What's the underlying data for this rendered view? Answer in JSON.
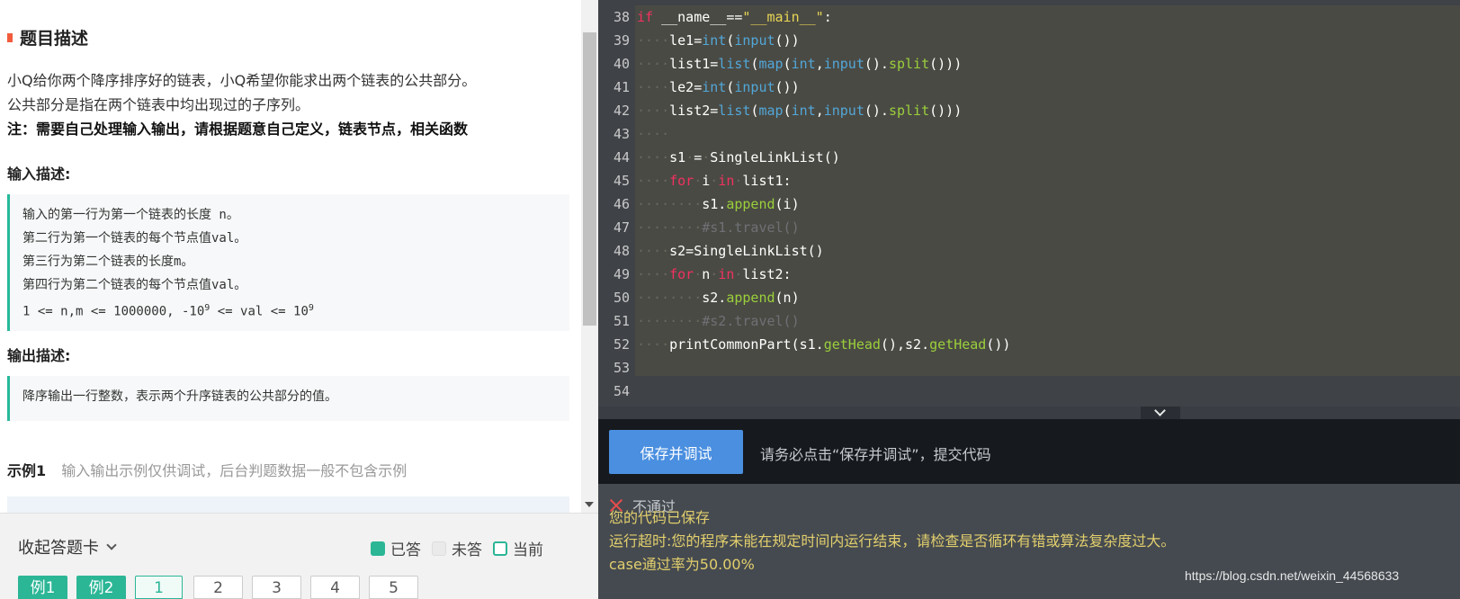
{
  "problem": {
    "section_title": "题目描述",
    "desc_lines": [
      "小Q给你两个降序排序好的链表，小Q希望你能求出两个链表的公共部分。",
      "公共部分是指在两个链表中均出现过的子序列。"
    ],
    "desc_note": "注：需要自己处理输入输出，请根据题意自己定义，链表节点，相关函数",
    "input_title": "输入描述:",
    "input_lines": [
      "输入的第一行为第一个链表的长度 n。",
      "第二行为第一个链表的每个节点值val。",
      "第三行为第二个链表的长度m。",
      "第四行为第二个链表的每个节点值val。"
    ],
    "input_range_prefix": "1 <= n,m <= 1000000, -10",
    "input_range_mid": " <= val <= 10",
    "input_range_exp": "9",
    "output_title": "输出描述:",
    "output_line": "降序输出一行整数，表示两个升序链表的公共部分的值。",
    "example_label": "示例1",
    "example_note": "输入输出示例仅供调试，后台判题数据一般不包含示例"
  },
  "answer_card": {
    "collapse_label": "收起答题卡",
    "legend_answered": "已答",
    "legend_unanswered": "未答",
    "legend_current": "当前",
    "buttons": [
      "例1",
      "例2",
      "1",
      "2",
      "3",
      "4",
      "5"
    ]
  },
  "editor": {
    "line_numbers": [
      "38",
      "39",
      "40",
      "41",
      "42",
      "43",
      "44",
      "45",
      "46",
      "47",
      "48",
      "49",
      "50",
      "51",
      "52",
      "53",
      "54"
    ]
  },
  "action": {
    "save_label": "保存并调试",
    "hint": "请务必点击“保存并调试”，提交代码"
  },
  "result": {
    "status": "不通过",
    "saved": "您的代码已保存",
    "timeout": "运行超时:您的程序未能在规定时间内运行结束，请检查是否循环有错或算法复杂度过大。",
    "pass_rate": "case通过率为50.00%",
    "watermark": "https://blog.csdn.net/weixin_44568633"
  },
  "colors": {
    "accent_green": "#2bb696",
    "save_blue": "#4a8fe0",
    "error_red": "#e34d4d",
    "result_yellow": "#e2cf6d"
  }
}
